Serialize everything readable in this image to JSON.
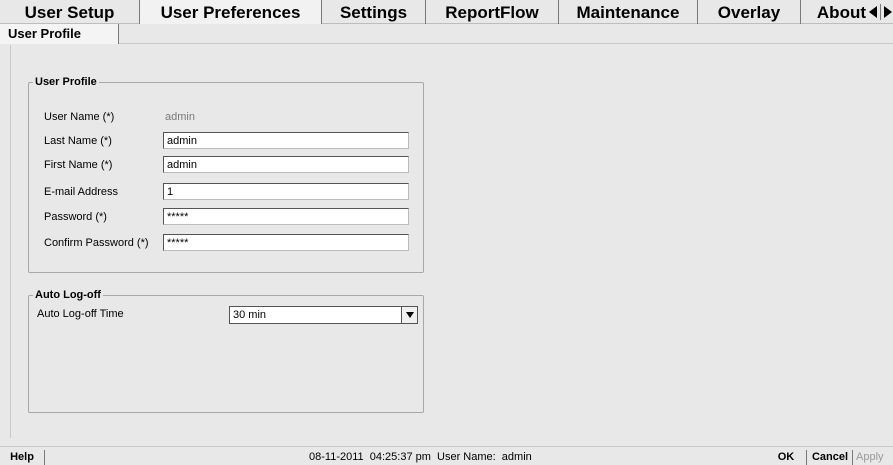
{
  "tabs": [
    {
      "label": "User Setup",
      "active": false
    },
    {
      "label": "User Preferences",
      "active": true
    },
    {
      "label": "Settings",
      "active": false
    },
    {
      "label": "ReportFlow",
      "active": false
    },
    {
      "label": "Maintenance",
      "active": false
    },
    {
      "label": "Overlay",
      "active": false
    },
    {
      "label": "About",
      "active": false
    }
  ],
  "subtabs": [
    {
      "label": "User Profile",
      "active": true
    }
  ],
  "user_profile": {
    "legend": "User Profile",
    "user_name_label": "User Name (*)",
    "user_name_value": "admin",
    "last_name_label": "Last Name (*)",
    "last_name_value": "admin",
    "first_name_label": "First Name (*)",
    "first_name_value": "admin",
    "email_label": "E-mail Address",
    "email_value": "1",
    "password_label": "Password (*)",
    "password_value": "*****",
    "confirm_password_label": "Confirm Password (*)",
    "confirm_password_value": "*****"
  },
  "auto_logoff": {
    "legend": "Auto Log-off",
    "time_label": "Auto Log-off Time",
    "time_value": "30 min"
  },
  "statusbar": {
    "help_label": "Help",
    "status_text": "08-11-2011  04:25:37 pm  User Name:  admin",
    "ok_label": "OK",
    "cancel_label": "Cancel",
    "apply_label": "Apply"
  },
  "icons": {
    "tab_scroll_left": "triangle-left-icon",
    "tab_scroll_right": "triangle-right-icon",
    "dropdown": "triangle-down-icon"
  },
  "colors": {
    "background": "#e8e8e8",
    "disabled_text": "#7a7a7a",
    "field_background": "#ffffff"
  }
}
